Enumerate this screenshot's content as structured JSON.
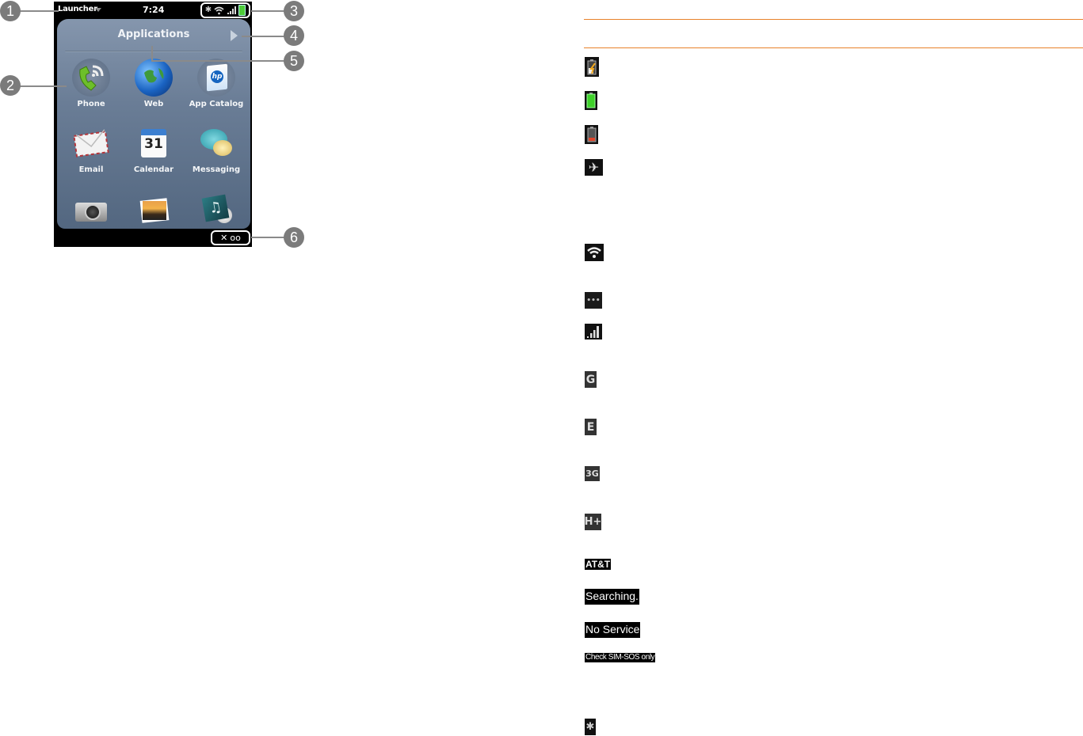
{
  "phone": {
    "status_bar": {
      "launcher_label": "Launcher",
      "time": "7:24",
      "icons": [
        "bluetooth-icon",
        "wifi-icon",
        "signal-bars-icon",
        "battery-full-icon"
      ]
    },
    "card": {
      "title": "Applications",
      "next_icon": "arrow-right-icon",
      "apps": [
        {
          "label": "Phone",
          "icon": "phone-icon"
        },
        {
          "label": "Web",
          "icon": "globe-icon"
        },
        {
          "label": "App Catalog",
          "icon": "hp-bag-icon"
        },
        {
          "label": "Email",
          "icon": "envelope-icon"
        },
        {
          "label": "Calendar",
          "icon": "calendar-icon",
          "day": "31"
        },
        {
          "label": "Messaging",
          "icon": "chat-bubbles-icon"
        },
        {
          "label": "",
          "icon": "camera-icon"
        },
        {
          "label": "",
          "icon": "photos-icon"
        },
        {
          "label": "",
          "icon": "music-icon"
        }
      ]
    },
    "notification_bar": {
      "icons": [
        "missed-call-icon",
        "voicemail-icon"
      ],
      "missed_call_glyph": "✕",
      "voicemail_glyph": "ᴏᴏ"
    }
  },
  "callouts": [
    "1",
    "2",
    "3",
    "4",
    "5",
    "6"
  ],
  "legend": {
    "accent_color": "#e8822a",
    "icons": [
      {
        "name": "battery-charging-icon"
      },
      {
        "name": "battery-full-icon"
      },
      {
        "name": "battery-low-icon"
      },
      {
        "name": "airplane-mode-icon",
        "glyph": "✈"
      },
      {
        "name": "wifi-connected-icon"
      },
      {
        "name": "wifi-searching-icon",
        "glyph": "•••"
      },
      {
        "name": "signal-strength-icon"
      },
      {
        "name": "network-gprs-icon",
        "glyph": "G"
      },
      {
        "name": "network-edge-icon",
        "glyph": "E"
      },
      {
        "name": "network-3g-icon",
        "glyph": "3G"
      },
      {
        "name": "network-hspa-plus-icon",
        "glyph": "H+"
      },
      {
        "name": "carrier-name",
        "text": "AT&T"
      },
      {
        "name": "searching-status",
        "text": "Searching."
      },
      {
        "name": "no-service-status",
        "text": "No Service"
      },
      {
        "name": "check-sim-status",
        "text": "Check SIM-SOS only"
      },
      {
        "name": "bluetooth-icon",
        "glyph": "✱"
      }
    ]
  }
}
